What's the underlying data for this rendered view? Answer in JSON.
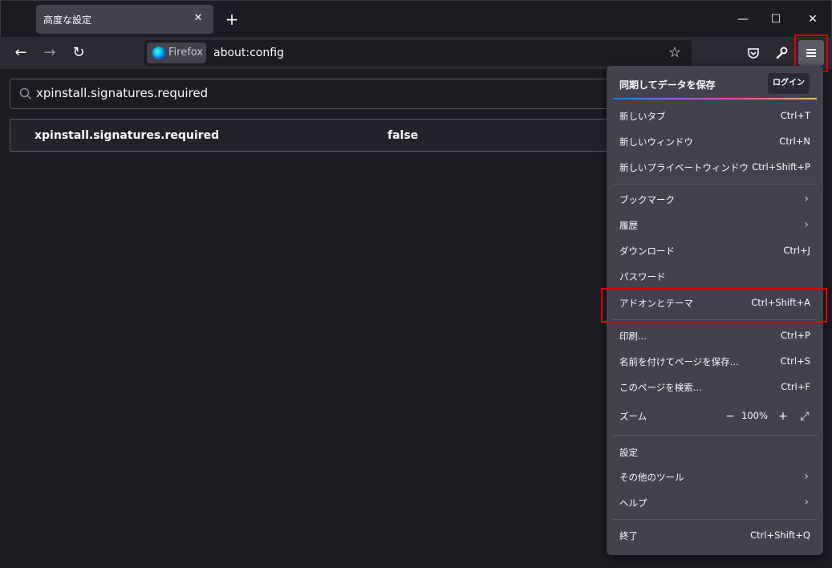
{
  "tab": {
    "title": "高度な設定",
    "close_glyph": "✕"
  },
  "newtab_glyph": "+",
  "window_controls": {
    "minimize": "—",
    "maximize": "☐",
    "close": "✕"
  },
  "nav": {
    "back": "←",
    "forward": "→",
    "reload": "↻"
  },
  "urlbar": {
    "identity_label": "Firefox",
    "url": "about:config",
    "star": "☆"
  },
  "search": {
    "value": "xpinstall.signatures.required"
  },
  "pref": {
    "name": "xpinstall.signatures.required",
    "value": "false"
  },
  "menu": {
    "header": "同期してデータを保存",
    "login_label": "ログイン",
    "new_tab": {
      "label": "新しいタブ",
      "shortcut": "Ctrl+T"
    },
    "new_window": {
      "label": "新しいウィンドウ",
      "shortcut": "Ctrl+N"
    },
    "new_private": {
      "label": "新しいプライベートウィンドウ",
      "shortcut": "Ctrl+Shift+P"
    },
    "bookmarks": {
      "label": "ブックマーク"
    },
    "history": {
      "label": "履歴"
    },
    "downloads": {
      "label": "ダウンロード",
      "shortcut": "Ctrl+J"
    },
    "passwords": {
      "label": "パスワード"
    },
    "addons": {
      "label": "アドオンとテーマ",
      "shortcut": "Ctrl+Shift+A"
    },
    "print": {
      "label": "印刷...",
      "shortcut": "Ctrl+P"
    },
    "save_page": {
      "label": "名前を付けてページを保存...",
      "shortcut": "Ctrl+S"
    },
    "find": {
      "label": "このページを検索...",
      "shortcut": "Ctrl+F"
    },
    "zoom": {
      "label": "ズーム",
      "minus": "−",
      "value": "100%",
      "plus": "+",
      "fullscreen": "⤢"
    },
    "settings": {
      "label": "設定"
    },
    "more_tools": {
      "label": "その他のツール"
    },
    "help": {
      "label": "ヘルプ"
    },
    "quit": {
      "label": "終了",
      "shortcut": "Ctrl+Shift+Q"
    },
    "arrow": "›"
  },
  "highlight_color": "#e00000"
}
